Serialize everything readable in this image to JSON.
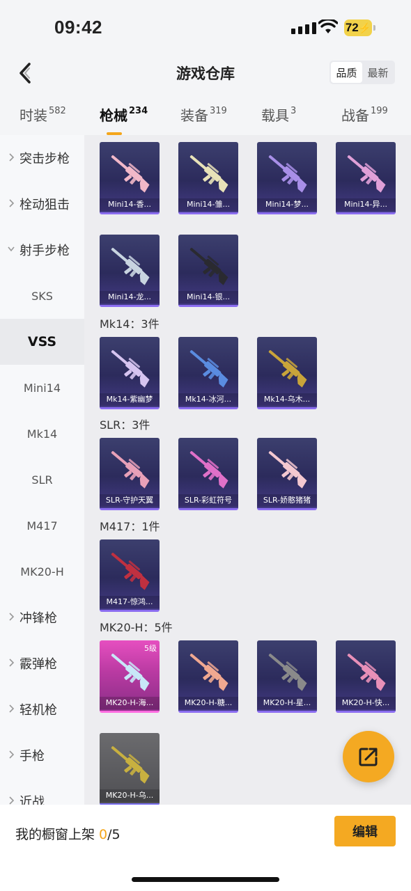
{
  "status": {
    "time": "09:42",
    "battery": "72"
  },
  "nav": {
    "title": "游戏仓库",
    "sort_options": [
      "品质",
      "最新"
    ]
  },
  "tabs": [
    {
      "label": "时装",
      "count": "582"
    },
    {
      "label": "枪械",
      "count": "234"
    },
    {
      "label": "装备",
      "count": "319"
    },
    {
      "label": "载具",
      "count": "3"
    },
    {
      "label": "战备",
      "count": "199"
    }
  ],
  "sidebar": [
    {
      "label": "突击步枪",
      "kind": "group",
      "expanded": false
    },
    {
      "label": "栓动狙击",
      "kind": "group",
      "expanded": false
    },
    {
      "label": "射手步枪",
      "kind": "group",
      "expanded": true
    },
    {
      "label": "SKS",
      "kind": "sub"
    },
    {
      "label": "VSS",
      "kind": "sub",
      "active": true
    },
    {
      "label": "Mini14",
      "kind": "sub"
    },
    {
      "label": "Mk14",
      "kind": "sub"
    },
    {
      "label": "SLR",
      "kind": "sub"
    },
    {
      "label": "M417",
      "kind": "sub"
    },
    {
      "label": "MK20-H",
      "kind": "sub"
    },
    {
      "label": "冲锋枪",
      "kind": "group",
      "expanded": false
    },
    {
      "label": "霰弹枪",
      "kind": "group",
      "expanded": false
    },
    {
      "label": "轻机枪",
      "kind": "group",
      "expanded": false
    },
    {
      "label": "手枪",
      "kind": "group",
      "expanded": false
    },
    {
      "label": "近战",
      "kind": "group",
      "expanded": false
    }
  ],
  "sections": [
    {
      "title": "",
      "items": [
        {
          "name": "Mini14-香...",
          "gun": "#f2b8c8"
        },
        {
          "name": "Mini14-雏...",
          "gun": "#e8e2b8"
        },
        {
          "name": "Mini14-梦...",
          "gun": "#a88fe8"
        },
        {
          "name": "Mini14-异...",
          "gun": "#e0a0d8"
        },
        {
          "name": "Mini14-龙...",
          "gun": "#c8d4e0"
        },
        {
          "name": "Mini14-银...",
          "gun": "#2a2a30"
        }
      ]
    },
    {
      "title": "Mk14：3件",
      "items": [
        {
          "name": "Mk14-紫幽梦",
          "gun": "#d6c4f0"
        },
        {
          "name": "Mk14-冰河...",
          "gun": "#5a8ce0"
        },
        {
          "name": "Mk14-乌木...",
          "gun": "#c9a43a"
        }
      ]
    },
    {
      "title": "SLR：3件",
      "items": [
        {
          "name": "SLR-守护天翼",
          "gun": "#e8a0b8"
        },
        {
          "name": "SLR-彩虹符号",
          "gun": "#e070c8"
        },
        {
          "name": "SLR-娇憨猪猪",
          "gun": "#f4c8d0"
        }
      ]
    },
    {
      "title": "M417：1件",
      "items": [
        {
          "name": "M417-惊鸿...",
          "gun": "#c03040"
        }
      ]
    },
    {
      "title": "MK20-H：5件",
      "items": [
        {
          "name": "MK20-H-海...",
          "gun": "#c8e8f8",
          "style": "pink",
          "level": "5级"
        },
        {
          "name": "MK20-H-糖...",
          "gun": "#f0a890"
        },
        {
          "name": "MK20-H-星...",
          "gun": "#8a8a8a"
        },
        {
          "name": "MK20-H-快...",
          "gun": "#e890b8"
        },
        {
          "name": "MK20-H-乌...",
          "gun": "#c8b040",
          "style": "gray"
        }
      ]
    }
  ],
  "footer": {
    "shelf_label": "我的橱窗上架 ",
    "shelf_count": "0",
    "shelf_total": "/5",
    "edit_label": "编辑"
  }
}
